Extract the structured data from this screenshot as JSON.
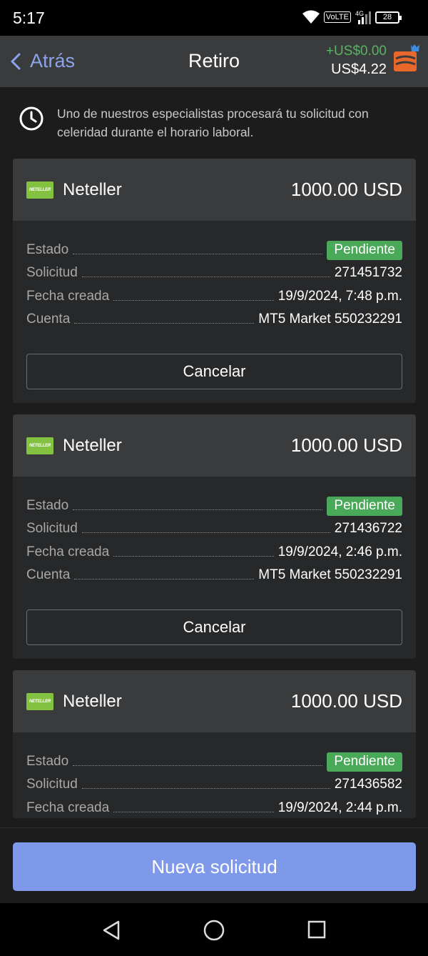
{
  "status_bar": {
    "time": "5:17",
    "network": "VoLTE",
    "signal_label": "4G",
    "battery": "28"
  },
  "header": {
    "back_label": "Atrás",
    "title": "Retiro",
    "balance_change": "+US$0.00",
    "balance_total": "US$4.22",
    "colors": {
      "accent": "#8ba4ee",
      "positive": "#58b463"
    }
  },
  "notice": {
    "icon": "clock-icon",
    "text": "Uno de nuestros especialistas procesará tu solicitud con celeridad durante el horario laboral."
  },
  "labels": {
    "status": "Estado",
    "request": "Solicitud",
    "created": "Fecha creada",
    "account": "Cuenta",
    "cancel": "Cancelar"
  },
  "withdrawals": [
    {
      "logo_text": "NETELLER",
      "method": "Neteller",
      "amount": "1000.00 USD",
      "status": "Pendiente",
      "request_id": "271451732",
      "created": "19/9/2024, 7:48 p.m.",
      "account": "MT5 Market 550232291"
    },
    {
      "logo_text": "NETELLER",
      "method": "Neteller",
      "amount": "1000.00 USD",
      "status": "Pendiente",
      "request_id": "271436722",
      "created": "19/9/2024, 2:46 p.m.",
      "account": "MT5 Market 550232291"
    },
    {
      "logo_text": "NETELLER",
      "method": "Neteller",
      "amount": "1000.00 USD",
      "status": "Pendiente",
      "request_id": "271436582",
      "created": "19/9/2024, 2:44 p.m.",
      "account": ""
    }
  ],
  "footer": {
    "new_request_label": "Nueva solicitud",
    "button_color": "#7f99ea"
  }
}
